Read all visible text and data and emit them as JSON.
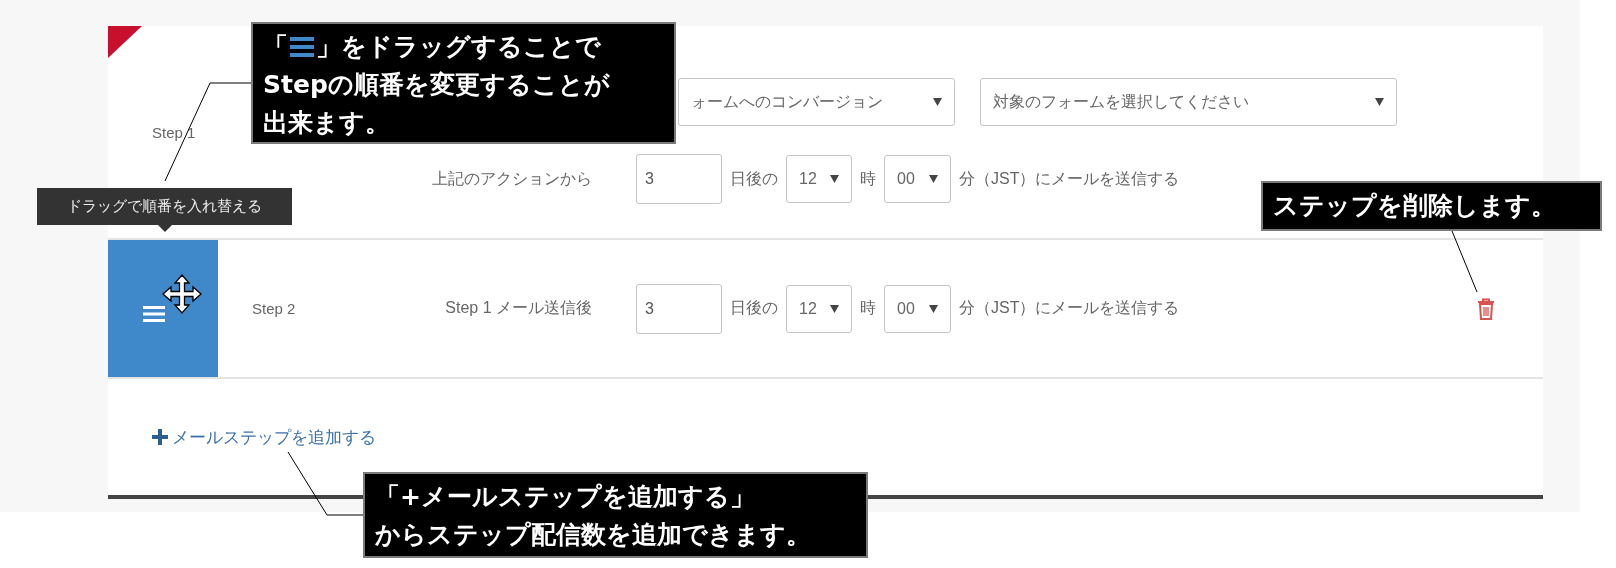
{
  "steps": [
    {
      "label": "Step 1",
      "handle_visible": false,
      "trigger_selects": [
        {
          "value": "ォームへのコンバージョン"
        },
        {
          "value": "対象のフォームを選択してください"
        }
      ],
      "trigger_label": "上記のアクションから",
      "days": "3",
      "days_suffix": "日後の",
      "hour": "12",
      "hour_suffix": "時",
      "minute": "00",
      "minute_suffix": "分（JST）にメールを送信する",
      "deletable": false
    },
    {
      "label": "Step 2",
      "handle_visible": true,
      "trigger_label": "Step 1 メール送信後",
      "days": "3",
      "days_suffix": "日後の",
      "hour": "12",
      "hour_suffix": "時",
      "minute": "00",
      "minute_suffix": "分（JST）にメールを送信する",
      "deletable": true
    }
  ],
  "add_step_link": "メールステップを追加する",
  "drag_tooltip": "ドラッグで順番を入れ替える",
  "annotations": [
    {
      "kind": "drag",
      "before": "「",
      "after": "」をドラッグすることで",
      "lines": [
        "Stepの順番を変更することが",
        "出来ます。"
      ]
    },
    {
      "kind": "delete",
      "lines": [
        "ステップを削除します。"
      ]
    },
    {
      "kind": "add",
      "lines": [
        "「+メールステップを追加する」",
        "からステップ配信数を追加できます。"
      ]
    }
  ]
}
